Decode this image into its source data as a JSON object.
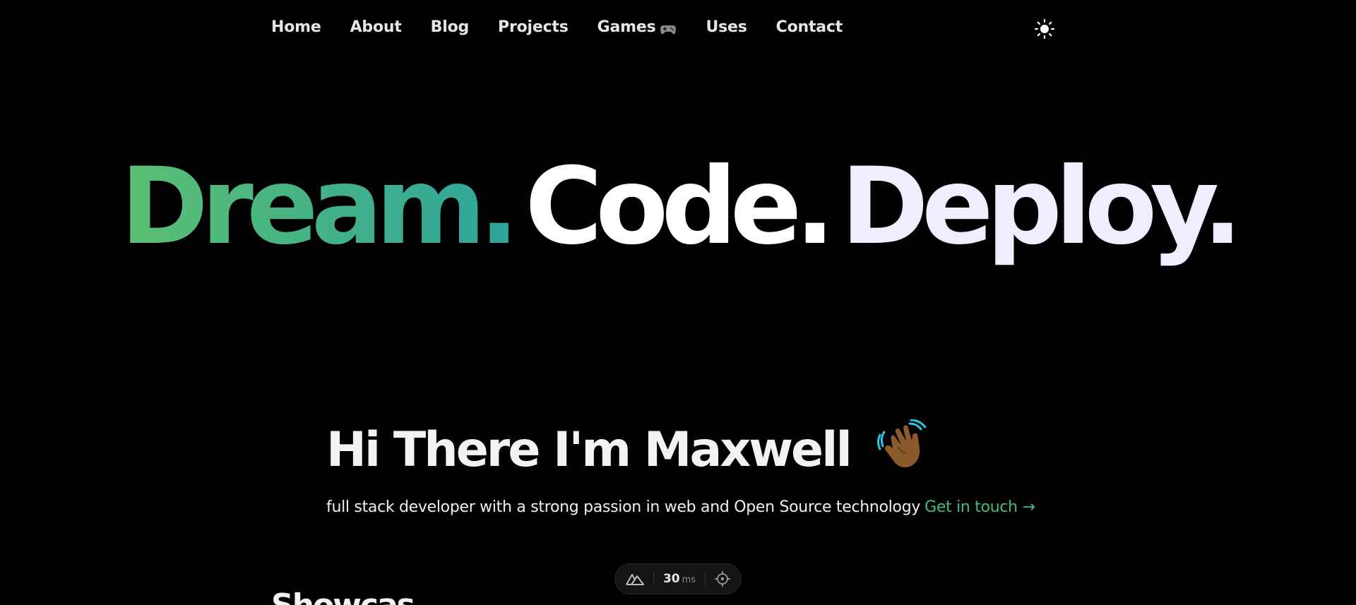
{
  "nav": {
    "items": [
      {
        "label": "Home"
      },
      {
        "label": "About"
      },
      {
        "label": "Blog"
      },
      {
        "label": "Projects"
      },
      {
        "label": "Games",
        "icon": "gamepad-icon"
      },
      {
        "label": "Uses"
      },
      {
        "label": "Contact"
      }
    ],
    "theme_toggle_icon": "sun-icon"
  },
  "hero": {
    "word1": "Dream.",
    "word2": "Code.",
    "word3": "Deploy.",
    "gradient_colors": [
      "#5bbf72",
      "#2ea59b"
    ]
  },
  "intro": {
    "heading": "Hi There I'm Maxwell",
    "wave_icon": "waving-hand-icon",
    "text": "full stack developer with a strong passion in web and Open Source technology",
    "cta": "Get in touch →",
    "cta_color": "#3fbf7f"
  },
  "dev_badge": {
    "logo_icon": "nuxt-logo-icon",
    "value": "30",
    "unit": "ms",
    "target_icon": "crosshair-icon"
  },
  "section": {
    "heading_partial": "Showcas"
  }
}
